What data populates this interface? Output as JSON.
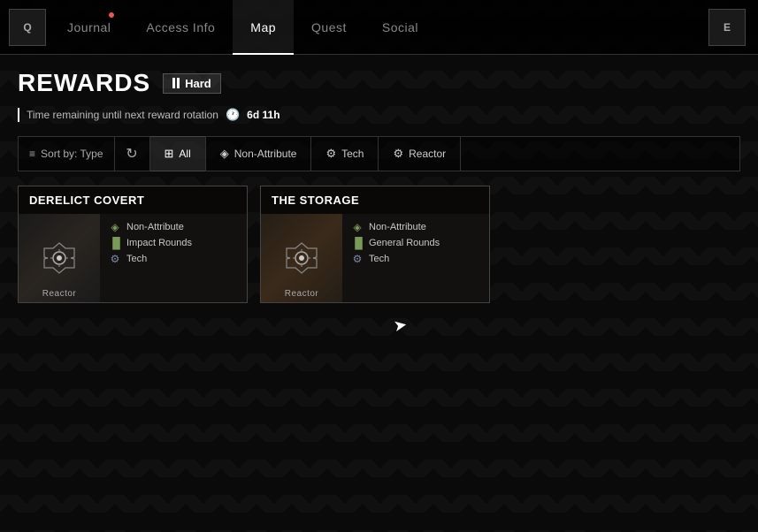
{
  "nav": {
    "left_btn": "Q",
    "right_btn": "E",
    "tabs": [
      {
        "id": "journal",
        "label": "Journal",
        "active": false,
        "notification": true
      },
      {
        "id": "access-info",
        "label": "Access Info",
        "active": false,
        "notification": false
      },
      {
        "id": "map",
        "label": "Map",
        "active": true,
        "notification": false
      },
      {
        "id": "quest",
        "label": "Quest",
        "active": false,
        "notification": false
      },
      {
        "id": "social",
        "label": "Social",
        "active": false,
        "notification": false
      }
    ]
  },
  "page": {
    "title": "Rewards",
    "difficulty": {
      "label": "Hard"
    },
    "timer": {
      "prefix": "Time remaining until next reward rotation",
      "value": "6d 11h"
    }
  },
  "filter": {
    "sort_label": "Sort by: Type",
    "options": [
      {
        "id": "all",
        "label": "All",
        "active": true,
        "icon": "⊞"
      },
      {
        "id": "non-attribute",
        "label": "Non-Attribute",
        "active": false,
        "icon": "◈"
      },
      {
        "id": "tech",
        "label": "Tech",
        "active": false,
        "icon": "⚙"
      },
      {
        "id": "reactor",
        "label": "Reactor",
        "active": false,
        "icon": "⚙"
      }
    ]
  },
  "locations": [
    {
      "id": "derelict-covert",
      "name": "Derelict Covert",
      "icon_type": "reactor",
      "icon_label": "Reactor",
      "rewards": [
        {
          "id": "non-attribute",
          "label": "Non-Attribute",
          "icon_type": "attribute"
        },
        {
          "id": "impact-rounds",
          "label": "Impact Rounds",
          "icon_type": "ammo"
        },
        {
          "id": "tech",
          "label": "Tech",
          "icon_type": "tech"
        }
      ]
    },
    {
      "id": "the-storage",
      "name": "The Storage",
      "icon_type": "reactor",
      "icon_label": "Reactor",
      "rewards": [
        {
          "id": "non-attribute",
          "label": "Non-Attribute",
          "icon_type": "attribute"
        },
        {
          "id": "general-rounds",
          "label": "General Rounds",
          "icon_type": "ammo"
        },
        {
          "id": "tech",
          "label": "Tech",
          "icon_type": "tech"
        }
      ]
    }
  ]
}
